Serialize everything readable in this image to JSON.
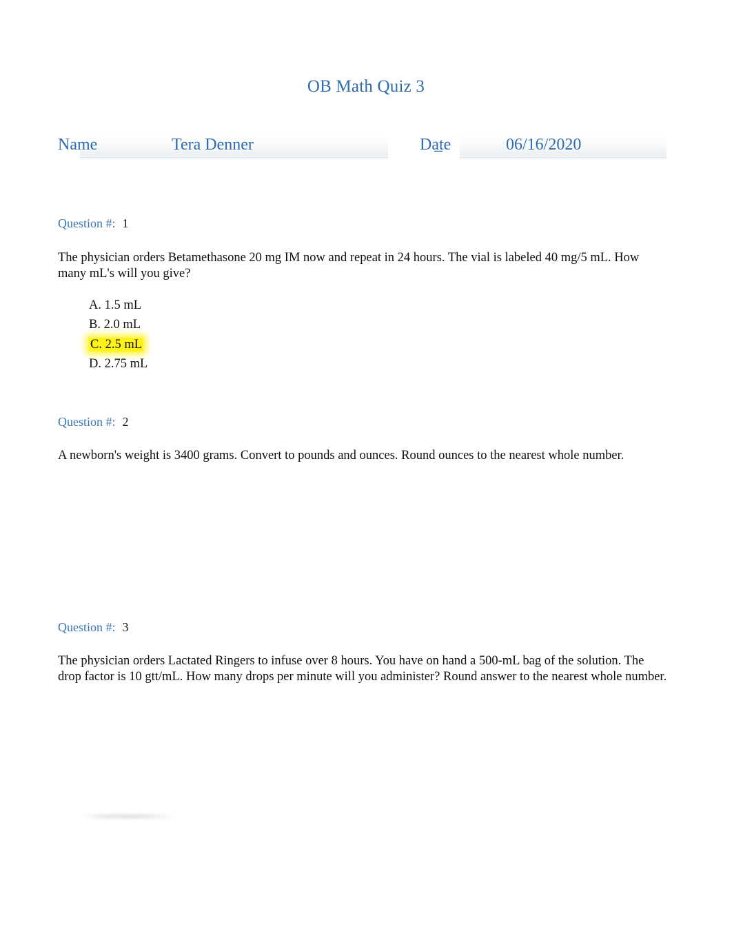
{
  "document": {
    "title": "OB Math Quiz 3"
  },
  "form": {
    "name_label": "Name",
    "name_value": "Tera Denner",
    "separator": "_",
    "date_label": "Date",
    "date_value": "06/16/2020"
  },
  "questions": [
    {
      "head_label": "Question #:",
      "number": "1",
      "body": "The physician orders Betamethasone 20 mg IM now and repeat in 24 hours. The vial is labeled 40 mg/5 mL. How many mL's will you give?",
      "options": [
        {
          "text": "A. 1.5 mL",
          "highlighted": false
        },
        {
          "text": "B. 2.0 mL",
          "highlighted": false
        },
        {
          "text": "C. 2.5 mL",
          "highlighted": true
        },
        {
          "text": "D. 2.75 mL",
          "highlighted": false
        }
      ]
    },
    {
      "head_label": "Question #:",
      "number": "2",
      "body": "A newborn's weight is 3400 grams. Convert to pounds and ounces.  Round ounces to the nearest whole number."
    },
    {
      "head_label": "Question #:",
      "number": "3",
      "body": "The physician orders Lactated Ringers to infuse over 8 hours. You have on hand a 500-mL bag of the solution. The drop factor is 10 gtt/mL. How many drops per minute will you administer? Round answer to the nearest whole number."
    }
  ],
  "colors": {
    "heading_blue": "#2E6CAF",
    "question_blue": "#3B77B5",
    "highlight_yellow": "#FFF21A",
    "body_black": "#101010",
    "page_background": "#FFFFFF"
  }
}
